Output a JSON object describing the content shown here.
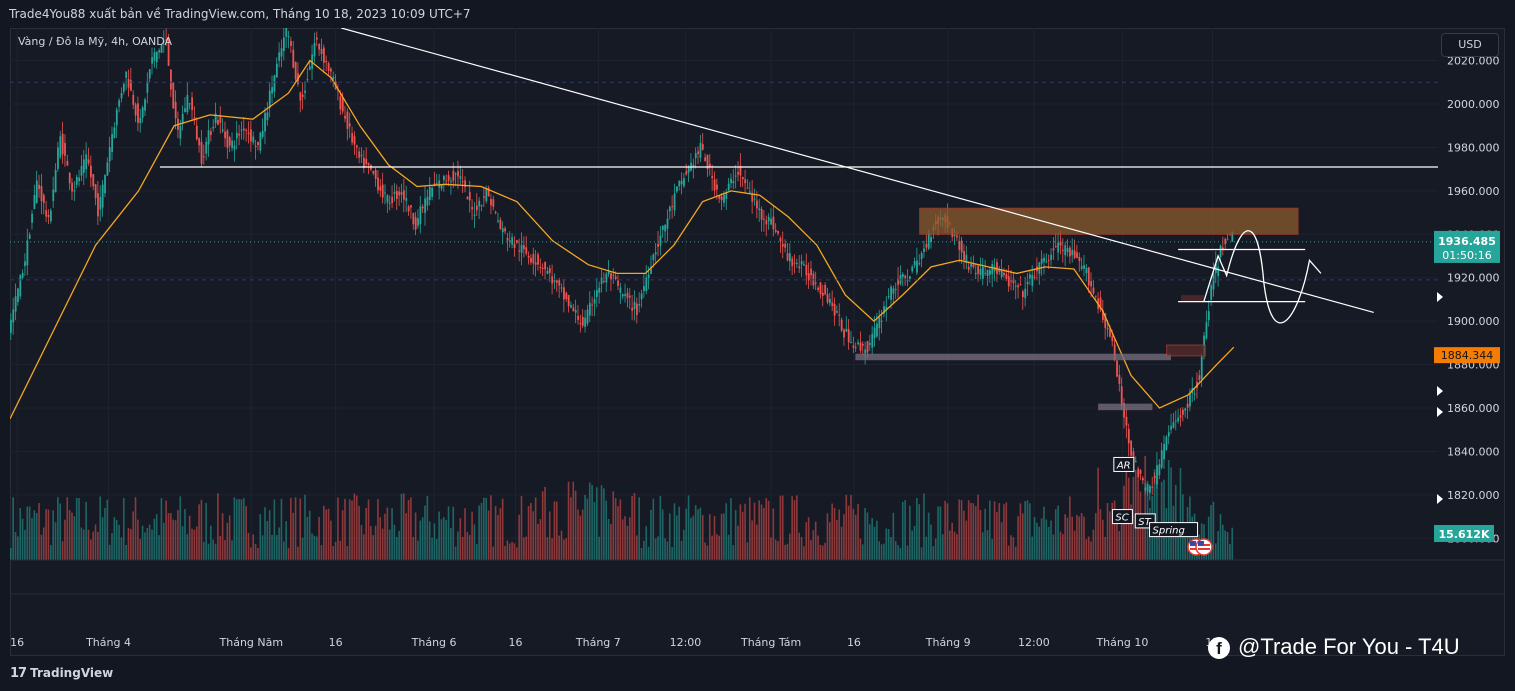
{
  "header": {
    "publisher_line": "Trade4You88 xuất bản về TradingView.com, Tháng 10 18, 2023 10:09 UTC+7"
  },
  "chart": {
    "symbol_label": "Vàng / Đô la Mỹ, 4h, OANDA",
    "currency_button": "USD"
  },
  "footer": {
    "tradingview_label": "TradingView",
    "watermark_text": "@Trade For You - T4U"
  },
  "colors": {
    "up": "#26a69a",
    "down": "#ef5350",
    "ma": "#f5a623",
    "supply_zone": "#8b5a2b",
    "last_price_bg": "#26a69a",
    "ma_price_bg": "#f57c00",
    "volume_badge_bg": "#26a69a"
  },
  "chart_data": {
    "type": "candlestick",
    "price_axis": {
      "ticks": [
        {
          "value": 2020,
          "label": "2020.000"
        },
        {
          "value": 2000,
          "label": "2000.000"
        },
        {
          "value": 1980,
          "label": "1980.000"
        },
        {
          "value": 1960,
          "label": "1960.000"
        },
        {
          "value": 1940,
          "label": "1940.000"
        },
        {
          "value": 1920,
          "label": "1920.000"
        },
        {
          "value": 1900,
          "label": "1900.000"
        },
        {
          "value": 1880,
          "label": "1880.000"
        },
        {
          "value": 1860,
          "label": "1860.000"
        },
        {
          "value": 1840,
          "label": "1840.000"
        },
        {
          "value": 1820,
          "label": "1820.000"
        },
        {
          "value": 1800,
          "label": "1800.000"
        }
      ],
      "ylim": [
        1790,
        2035
      ]
    },
    "time_axis": {
      "ticks": [
        {
          "label": "16",
          "pos": 0.005
        },
        {
          "label": "Tháng 4",
          "pos": 0.069
        },
        {
          "label": "Tháng Năm",
          "pos": 0.169
        },
        {
          "label": "16",
          "pos": 0.228
        },
        {
          "label": "Tháng 6",
          "pos": 0.297
        },
        {
          "label": "16",
          "pos": 0.354
        },
        {
          "label": "Tháng 7",
          "pos": 0.412
        },
        {
          "label": "12:00",
          "pos": 0.473
        },
        {
          "label": "Tháng Tám",
          "pos": 0.533
        },
        {
          "label": "16",
          "pos": 0.591
        },
        {
          "label": "Tháng 9",
          "pos": 0.657
        },
        {
          "label": "12:00",
          "pos": 0.717
        },
        {
          "label": "Tháng 10",
          "pos": 0.779
        },
        {
          "label": "17",
          "pos": 0.842
        }
      ]
    },
    "price_path": [
      [
        0.0,
        1895
      ],
      [
        0.012,
        1930
      ],
      [
        0.02,
        1965
      ],
      [
        0.028,
        1945
      ],
      [
        0.036,
        1985
      ],
      [
        0.045,
        1960
      ],
      [
        0.055,
        1975
      ],
      [
        0.063,
        1950
      ],
      [
        0.072,
        1985
      ],
      [
        0.082,
        2015
      ],
      [
        0.092,
        1990
      ],
      [
        0.1,
        2020
      ],
      [
        0.11,
        2030
      ],
      [
        0.118,
        1985
      ],
      [
        0.126,
        2005
      ],
      [
        0.135,
        1975
      ],
      [
        0.145,
        1995
      ],
      [
        0.155,
        1980
      ],
      [
        0.165,
        1990
      ],
      [
        0.175,
        1980
      ],
      [
        0.185,
        2010
      ],
      [
        0.195,
        2035
      ],
      [
        0.205,
        2000
      ],
      [
        0.215,
        2030
      ],
      [
        0.225,
        2015
      ],
      [
        0.235,
        1995
      ],
      [
        0.245,
        1975
      ],
      [
        0.255,
        1968
      ],
      [
        0.265,
        1955
      ],
      [
        0.275,
        1960
      ],
      [
        0.285,
        1945
      ],
      [
        0.295,
        1960
      ],
      [
        0.305,
        1965
      ],
      [
        0.315,
        1968
      ],
      [
        0.325,
        1950
      ],
      [
        0.335,
        1960
      ],
      [
        0.345,
        1942
      ],
      [
        0.355,
        1935
      ],
      [
        0.365,
        1930
      ],
      [
        0.375,
        1925
      ],
      [
        0.385,
        1915
      ],
      [
        0.395,
        1905
      ],
      [
        0.403,
        1898
      ],
      [
        0.412,
        1915
      ],
      [
        0.42,
        1922
      ],
      [
        0.43,
        1912
      ],
      [
        0.44,
        1905
      ],
      [
        0.45,
        1928
      ],
      [
        0.46,
        1945
      ],
      [
        0.468,
        1960
      ],
      [
        0.476,
        1970
      ],
      [
        0.485,
        1980
      ],
      [
        0.493,
        1965
      ],
      [
        0.5,
        1955
      ],
      [
        0.51,
        1970
      ],
      [
        0.518,
        1960
      ],
      [
        0.526,
        1950
      ],
      [
        0.535,
        1945
      ],
      [
        0.545,
        1930
      ],
      [
        0.555,
        1925
      ],
      [
        0.565,
        1918
      ],
      [
        0.575,
        1910
      ],
      [
        0.585,
        1895
      ],
      [
        0.595,
        1888
      ],
      [
        0.602,
        1888
      ],
      [
        0.61,
        1900
      ],
      [
        0.618,
        1915
      ],
      [
        0.628,
        1920
      ],
      [
        0.638,
        1928
      ],
      [
        0.648,
        1945
      ],
      [
        0.655,
        1948
      ],
      [
        0.662,
        1940
      ],
      [
        0.67,
        1928
      ],
      [
        0.68,
        1922
      ],
      [
        0.69,
        1925
      ],
      [
        0.7,
        1918
      ],
      [
        0.71,
        1913
      ],
      [
        0.718,
        1922
      ],
      [
        0.726,
        1928
      ],
      [
        0.735,
        1935
      ],
      [
        0.745,
        1930
      ],
      [
        0.755,
        1922
      ],
      [
        0.763,
        1908
      ],
      [
        0.772,
        1892
      ],
      [
        0.78,
        1860
      ],
      [
        0.788,
        1835
      ],
      [
        0.796,
        1822
      ],
      [
        0.803,
        1828
      ],
      [
        0.81,
        1845
      ],
      [
        0.818,
        1855
      ],
      [
        0.826,
        1862
      ],
      [
        0.834,
        1875
      ],
      [
        0.842,
        1915
      ],
      [
        0.85,
        1935
      ],
      [
        0.857,
        1940
      ]
    ],
    "ma_path": [
      [
        0.0,
        1855
      ],
      [
        0.03,
        1895
      ],
      [
        0.06,
        1935
      ],
      [
        0.09,
        1960
      ],
      [
        0.115,
        1990
      ],
      [
        0.14,
        1995
      ],
      [
        0.17,
        1993
      ],
      [
        0.195,
        2005
      ],
      [
        0.21,
        2020
      ],
      [
        0.225,
        2012
      ],
      [
        0.245,
        1990
      ],
      [
        0.265,
        1972
      ],
      [
        0.285,
        1962
      ],
      [
        0.305,
        1963
      ],
      [
        0.33,
        1962
      ],
      [
        0.355,
        1955
      ],
      [
        0.38,
        1937
      ],
      [
        0.405,
        1926
      ],
      [
        0.425,
        1922
      ],
      [
        0.445,
        1922
      ],
      [
        0.465,
        1935
      ],
      [
        0.485,
        1955
      ],
      [
        0.505,
        1960
      ],
      [
        0.525,
        1958
      ],
      [
        0.545,
        1948
      ],
      [
        0.565,
        1935
      ],
      [
        0.585,
        1912
      ],
      [
        0.605,
        1900
      ],
      [
        0.625,
        1912
      ],
      [
        0.645,
        1925
      ],
      [
        0.665,
        1928
      ],
      [
        0.685,
        1925
      ],
      [
        0.705,
        1922
      ],
      [
        0.725,
        1925
      ],
      [
        0.745,
        1924
      ],
      [
        0.765,
        1905
      ],
      [
        0.785,
        1875
      ],
      [
        0.805,
        1860
      ],
      [
        0.825,
        1866
      ],
      [
        0.845,
        1880
      ],
      [
        0.857,
        1888
      ]
    ],
    "horizontal_lines": [
      {
        "price": 1971,
        "from": 0.105,
        "to": 1.0,
        "style": "white"
      },
      {
        "price": 1936.485,
        "from": 0.0,
        "to": 1.0,
        "style": "green-dotted"
      },
      {
        "price": 2010,
        "from": 0.0,
        "to": 1.0,
        "style": "blue-dashed"
      },
      {
        "price": 1919,
        "from": 0.0,
        "to": 1.0,
        "style": "blue-dashed"
      }
    ],
    "trendline": {
      "from": [
        0.232,
        2035
      ],
      "to": [
        0.955,
        1904
      ]
    },
    "zones": [
      {
        "name": "supply-zone",
        "x1": 0.637,
        "x2": 0.902,
        "y1": 1952,
        "y2": 1940,
        "fill": "#8b5a2b",
        "stroke": "#b8402f"
      },
      {
        "name": "support-bar-1",
        "x1": 0.592,
        "x2": 0.813,
        "y1": 1885,
        "y2": 1882,
        "fill": "#7a6f80"
      },
      {
        "name": "support-bar-2",
        "x1": 0.762,
        "x2": 0.8,
        "y1": 1862,
        "y2": 1859,
        "fill": "#7a6f80"
      },
      {
        "name": "small-zone",
        "x1": 0.81,
        "x2": 0.837,
        "y1": 1889,
        "y2": 1884,
        "fill": "#5a2a2a",
        "stroke": "#b8402f"
      },
      {
        "name": "small-zone-2",
        "x1": 0.82,
        "x2": 0.836,
        "y1": 1912,
        "y2": 1909,
        "fill": "#5a2a2a"
      }
    ],
    "rectangle_box": {
      "x1": 0.818,
      "x2": 0.907,
      "y1": 1933,
      "y2": 1909
    },
    "annotations": [
      {
        "text": "AR",
        "x": 0.773,
        "price": 1834
      },
      {
        "text": "SC",
        "x": 0.772,
        "price": 1810
      },
      {
        "text": "ST",
        "x": 0.788,
        "price": 1808
      },
      {
        "text": "Spring",
        "x": 0.798,
        "price": 1804
      }
    ],
    "price_labels": {
      "last_price": "1936.485",
      "countdown": "01:50:16",
      "ma_price": "1884.344",
      "ma_price_value": 1884.344,
      "volume": "15.612K"
    }
  }
}
